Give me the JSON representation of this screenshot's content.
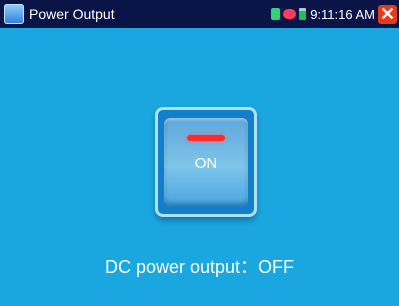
{
  "app": {
    "title": "Power Output"
  },
  "status_bar": {
    "time": "9:11:16 AM",
    "icons": [
      "sd-card-icon",
      "network-icon",
      "battery-icon"
    ],
    "close_label": "✕"
  },
  "switch": {
    "label": "ON",
    "indicator_color": "#ff2b2b"
  },
  "status": {
    "text": "DC power output：OFF"
  },
  "colors": {
    "background": "#1aa7df",
    "title_bar": "#0b1446",
    "close_button": "#e33c18"
  }
}
